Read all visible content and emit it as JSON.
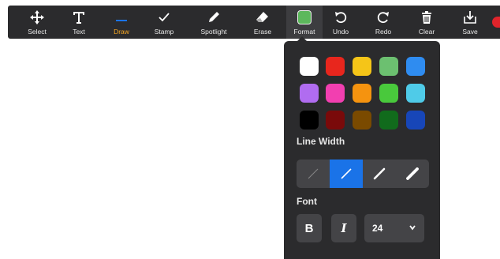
{
  "toolbar": {
    "tools": [
      {
        "name": "select",
        "label": "Select",
        "icon": "move-arrows-icon"
      },
      {
        "name": "text",
        "label": "Text",
        "icon": "text-t-icon"
      },
      {
        "name": "draw",
        "label": "Draw",
        "icon": "draw-line-icon"
      },
      {
        "name": "stamp",
        "label": "Stamp",
        "icon": "checkmark-stamp-icon"
      },
      {
        "name": "spotlight",
        "label": "Spotlight",
        "icon": "spotlight-pen-icon"
      },
      {
        "name": "erase",
        "label": "Erase",
        "icon": "eraser-icon"
      },
      {
        "name": "format",
        "label": "Format",
        "icon": "format-swatch-icon"
      },
      {
        "name": "undo",
        "label": "Undo",
        "icon": "undo-icon"
      },
      {
        "name": "redo",
        "label": "Redo",
        "icon": "redo-icon"
      },
      {
        "name": "clear",
        "label": "Clear",
        "icon": "trash-icon"
      },
      {
        "name": "save",
        "label": "Save",
        "icon": "save-download-icon"
      }
    ],
    "active_tool_label_color": "#f5a623",
    "format_swatch_color": "#5cb85c",
    "record_indicator_color": "#e0242b"
  },
  "format_panel": {
    "colors": [
      [
        "#ffffff",
        "#e8261d",
        "#f5c518",
        "#6cc070",
        "#2f8cf0"
      ],
      [
        "#b06cf0",
        "#f23fb0",
        "#f5930f",
        "#49c93c",
        "#4fcbe8"
      ],
      [
        "#000000",
        "#7a0a0a",
        "#7a4a00",
        "#116b1c",
        "#1746b8"
      ]
    ],
    "line_width_label": "Line Width",
    "line_widths": [
      {
        "name": "thinnest",
        "selected": false
      },
      {
        "name": "thin",
        "selected": true
      },
      {
        "name": "medium",
        "selected": false
      },
      {
        "name": "thick",
        "selected": false
      }
    ],
    "font_label": "Font",
    "bold_label": "B",
    "italic_label": "I",
    "font_size": "24"
  }
}
